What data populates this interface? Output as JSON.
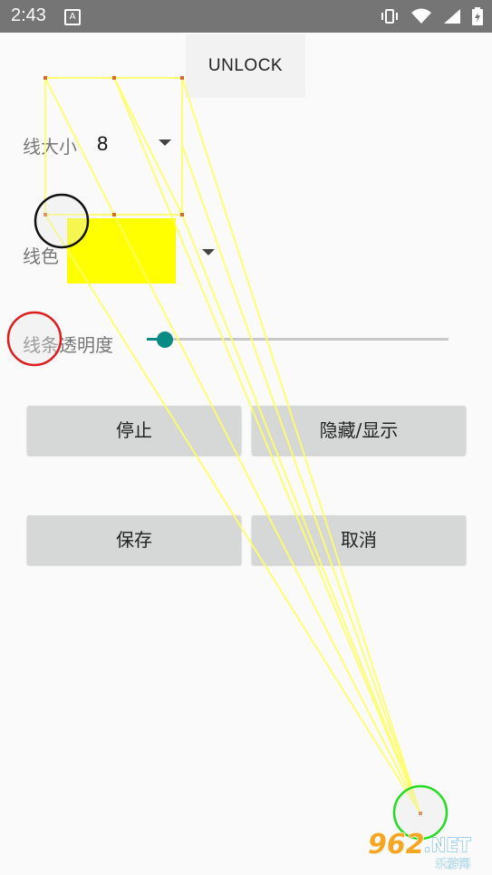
{
  "status_bar": {
    "time": "2:43",
    "notification_glyph": "A",
    "icons": [
      "vibrate-icon",
      "wifi-icon",
      "signal-icon",
      "battery-icon"
    ]
  },
  "unlock_label": "UNLOCK",
  "line_size": {
    "label": "线大小",
    "value": "8"
  },
  "line_color": {
    "label": "线色",
    "color": "#ffff00"
  },
  "line_opacity": {
    "label": "线条透明度",
    "fraction": 0.06
  },
  "buttons": {
    "stop": "停止",
    "hide_show": "隐藏/显示",
    "save": "保存",
    "cancel": "取消"
  },
  "watermark": {
    "number": "962",
    "suffix": ".NET",
    "subtitle": "乐游网"
  },
  "accent_color": "#0a8a84"
}
